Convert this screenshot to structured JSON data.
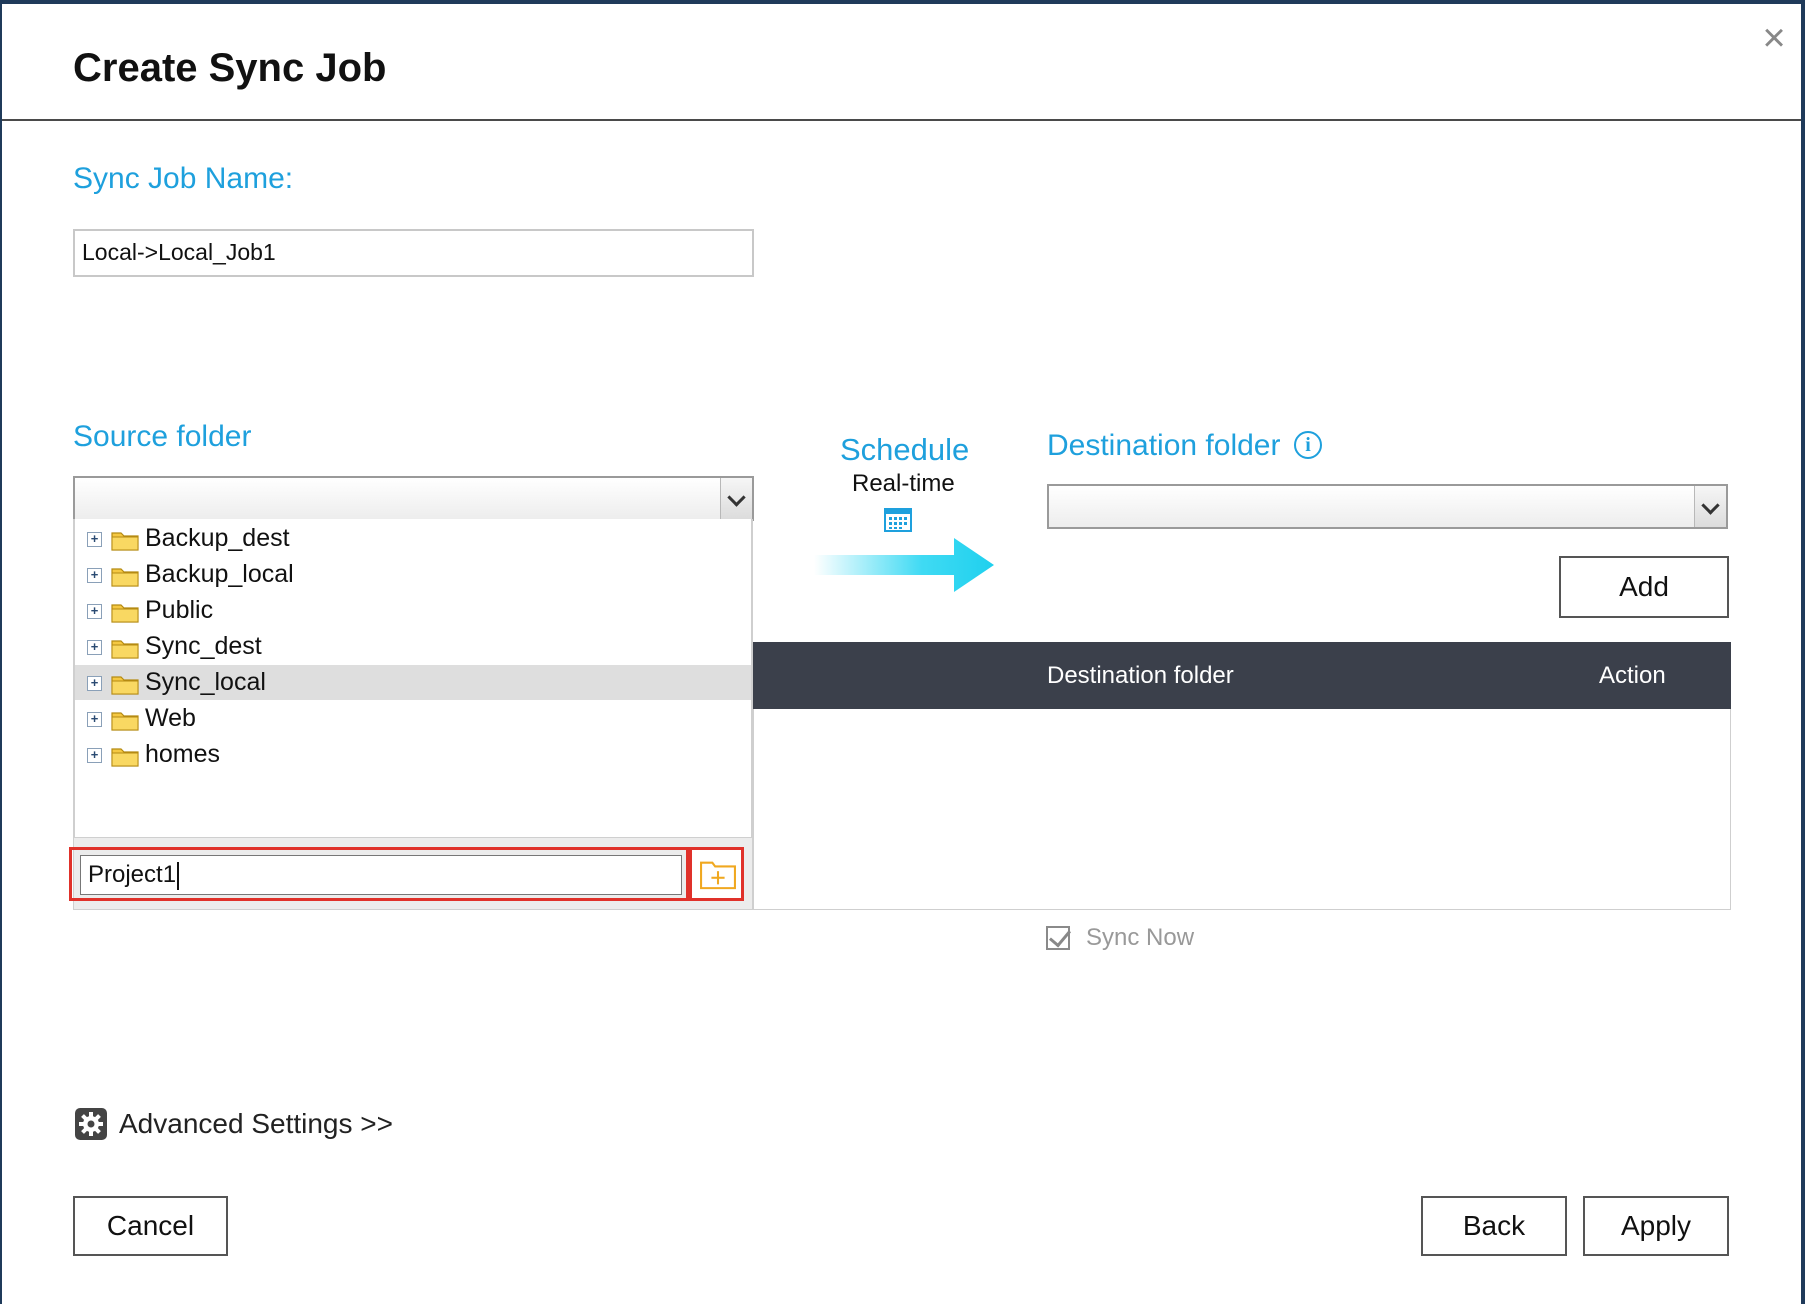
{
  "dialog": {
    "title": "Create Sync Job",
    "close_icon": "close-icon"
  },
  "job_name": {
    "label": "Sync Job Name:",
    "value": "Local->Local_Job1"
  },
  "source": {
    "label": "Source folder",
    "selected_value": "",
    "tree": [
      {
        "name": "Backup_dest",
        "selected": false
      },
      {
        "name": "Backup_local",
        "selected": false
      },
      {
        "name": "Public",
        "selected": false
      },
      {
        "name": "Sync_dest",
        "selected": false
      },
      {
        "name": "Sync_local",
        "selected": true
      },
      {
        "name": "Web",
        "selected": false
      },
      {
        "name": "homes",
        "selected": false
      }
    ],
    "new_folder_value": "Project1",
    "new_folder_icon": "new-folder-icon"
  },
  "schedule": {
    "label": "Schedule",
    "value": "Real-time",
    "icon": "calendar-icon"
  },
  "destination": {
    "label": "Destination folder",
    "info_glyph": "i",
    "selected_value": "",
    "add_label": "Add"
  },
  "table": {
    "columns": [
      "Destination folder",
      "Action"
    ],
    "rows": []
  },
  "sync_now": {
    "label": "Sync Now",
    "checked": true
  },
  "advanced": {
    "label": "Advanced Settings >>",
    "icon": "gear-icon"
  },
  "footer": {
    "cancel_label": "Cancel",
    "back_label": "Back",
    "apply_label": "Apply"
  },
  "colors": {
    "accent": "#1ea0dd",
    "header_bg": "#3b404b",
    "highlight": "#e0312a",
    "folder": "#f5c842"
  }
}
